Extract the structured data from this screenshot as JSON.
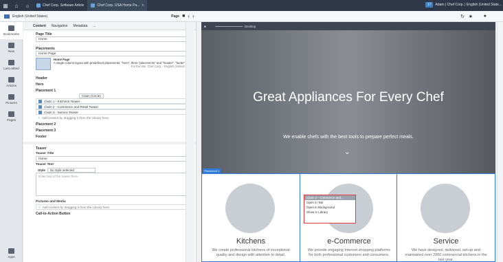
{
  "topbar": {
    "tabs": [
      {
        "label": "Chef Corp. Software Article"
      },
      {
        "label": "Chef Corp. USA Home Pa..."
      }
    ],
    "count": "17",
    "user": "Adam | Chef Corp. | English (United State..."
  },
  "toolbar": {
    "site": "English (United States)",
    "page_label": "Page"
  },
  "sidebar": {
    "items": [
      {
        "label": "Bookmarks"
      },
      {
        "label": "New"
      },
      {
        "label": "Last edited"
      },
      {
        "label": "Articles"
      },
      {
        "label": "Pictures"
      },
      {
        "label": "Pages"
      },
      {
        "label": "Apps"
      }
    ]
  },
  "form": {
    "tabs": [
      "Content",
      "Navigation",
      "Metadata",
      "..."
    ],
    "page_title_header": "Page Title",
    "page_title_value": "Home",
    "placements_header": "Placements",
    "layout_value": "Home Page",
    "layout_desc_title": "Home Page",
    "layout_desc": "A single column layout with predefined placements: \"hero\", three \"placements\" and \"header\", \"footer\".",
    "layout_meta": "For the site, Chef Corp. - English (United States)",
    "header": "Header",
    "hero": "Hero",
    "placement1": "Placement 1",
    "claim_select": "Claim (Circle)",
    "claims": [
      "Claim 1 - Kitchens Teaser",
      "Claim 2 - Commerce and Retail Teaser",
      "Claim 3 - Service Teaser"
    ],
    "add_hint": "Add content by dragging it from the Library here.",
    "placement2": "Placement 2",
    "placement3": "Placement 3",
    "footer": "Footer",
    "teaser_header": "Teaser",
    "teaser_title_label": "Teaser Title",
    "teaser_title_value": "Home",
    "teaser_text_label": "Teaser Text",
    "style_label": "Style",
    "style_value": "No style selected",
    "teaser_text_placeholder": "Enter text of the teaser here.",
    "pictures_label": "Pictures and Media",
    "cta_label": "Call-to-Action Button"
  },
  "preview": {
    "device": "Desktop",
    "hero_title": "Great Appliances For Every Chef",
    "hero_sub": "We enable chefs with the best tools to prepare perfect meals.",
    "placement_label": "Placement 1",
    "cards": [
      {
        "title": "Kitchens",
        "text": "We create professional kitchens of exceptional quality and design with attention to detail."
      },
      {
        "title": "e-Commerce",
        "text": "We provide engaging Internet shopping platforms for both professional customers and consumers."
      },
      {
        "title": "Service",
        "text": "We have designed, delivered, set-up and maintained over 2000 commercial kitchens in the last year."
      }
    ],
    "context_menu": {
      "title": "Claim 2 - Commerce and...",
      "items": [
        "Open in Tab",
        "Open in Background",
        "Show in Library"
      ]
    }
  }
}
